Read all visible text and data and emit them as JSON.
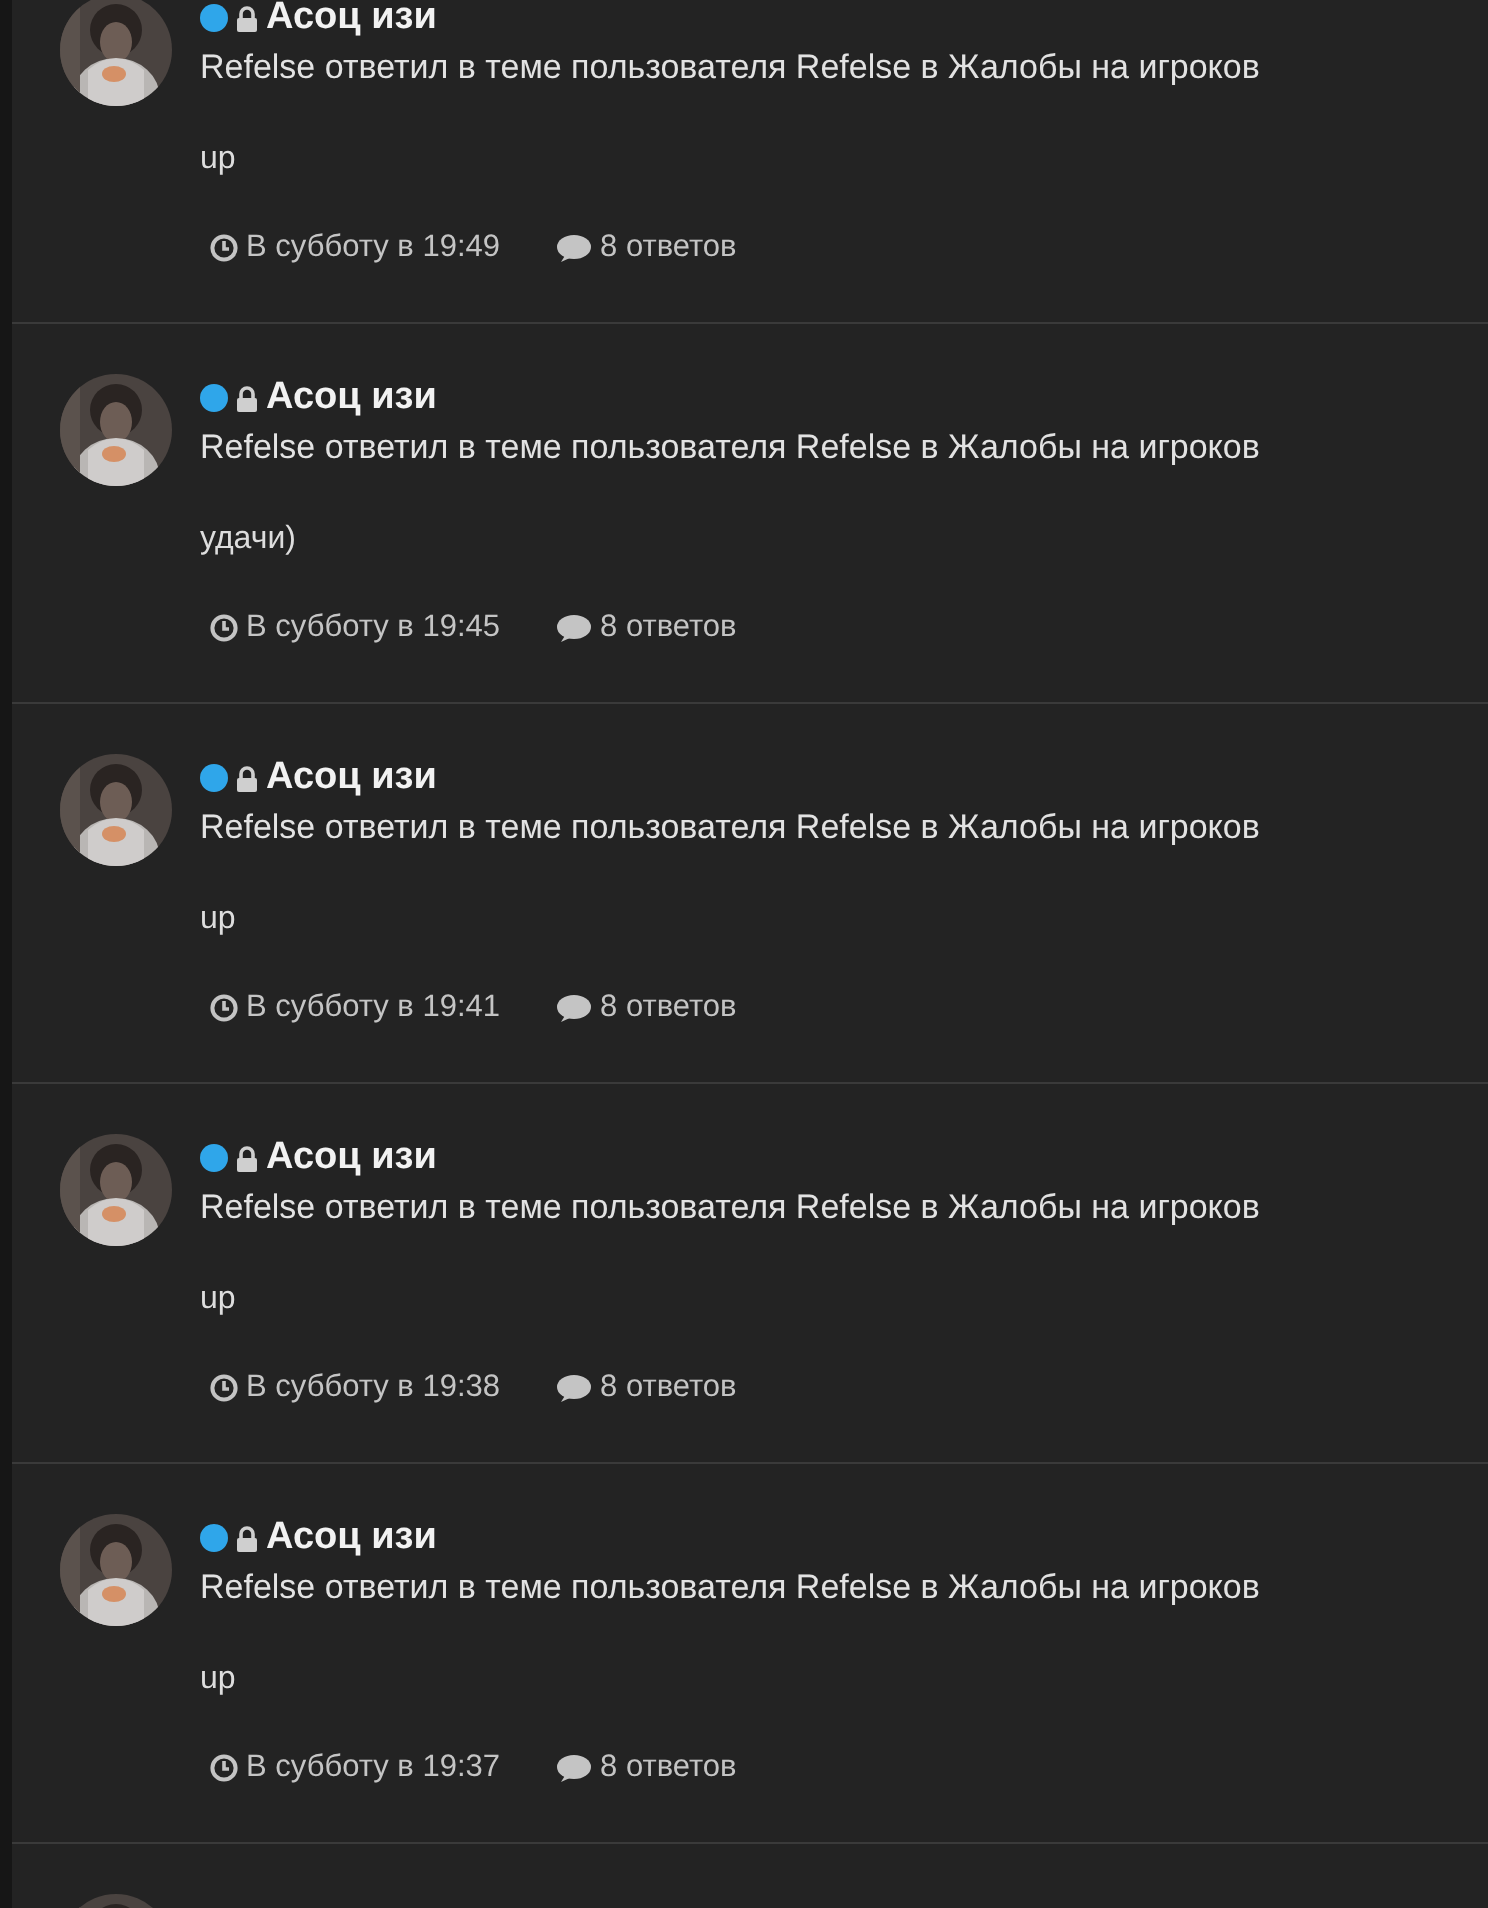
{
  "activities": [
    {
      "author": "Асоц изи",
      "online": true,
      "locked": true,
      "summary": "Refelse ответил в теме пользователя Refelse в Жалобы на игроков",
      "message": "up",
      "time": "В субботу в 19:49",
      "replies": "8 ответов"
    },
    {
      "author": "Асоц изи",
      "online": true,
      "locked": true,
      "summary": "Refelse ответил в теме пользователя Refelse в Жалобы на игроков",
      "message": "удачи)",
      "time": "В субботу в 19:45",
      "replies": "8 ответов"
    },
    {
      "author": "Асоц изи",
      "online": true,
      "locked": true,
      "summary": "Refelse ответил в теме пользователя Refelse в Жалобы на игроков",
      "message": "up",
      "time": "В субботу в 19:41",
      "replies": "8 ответов"
    },
    {
      "author": "Асоц изи",
      "online": true,
      "locked": true,
      "summary": "Refelse ответил в теме пользователя Refelse в Жалобы на игроков",
      "message": "up",
      "time": "В субботу в 19:38",
      "replies": "8 ответов"
    },
    {
      "author": "Асоц изи",
      "online": true,
      "locked": true,
      "summary": "Refelse ответил в теме пользователя Refelse в Жалобы на игроков",
      "message": "up",
      "time": "В субботу в 19:37",
      "replies": "8 ответов"
    }
  ]
}
